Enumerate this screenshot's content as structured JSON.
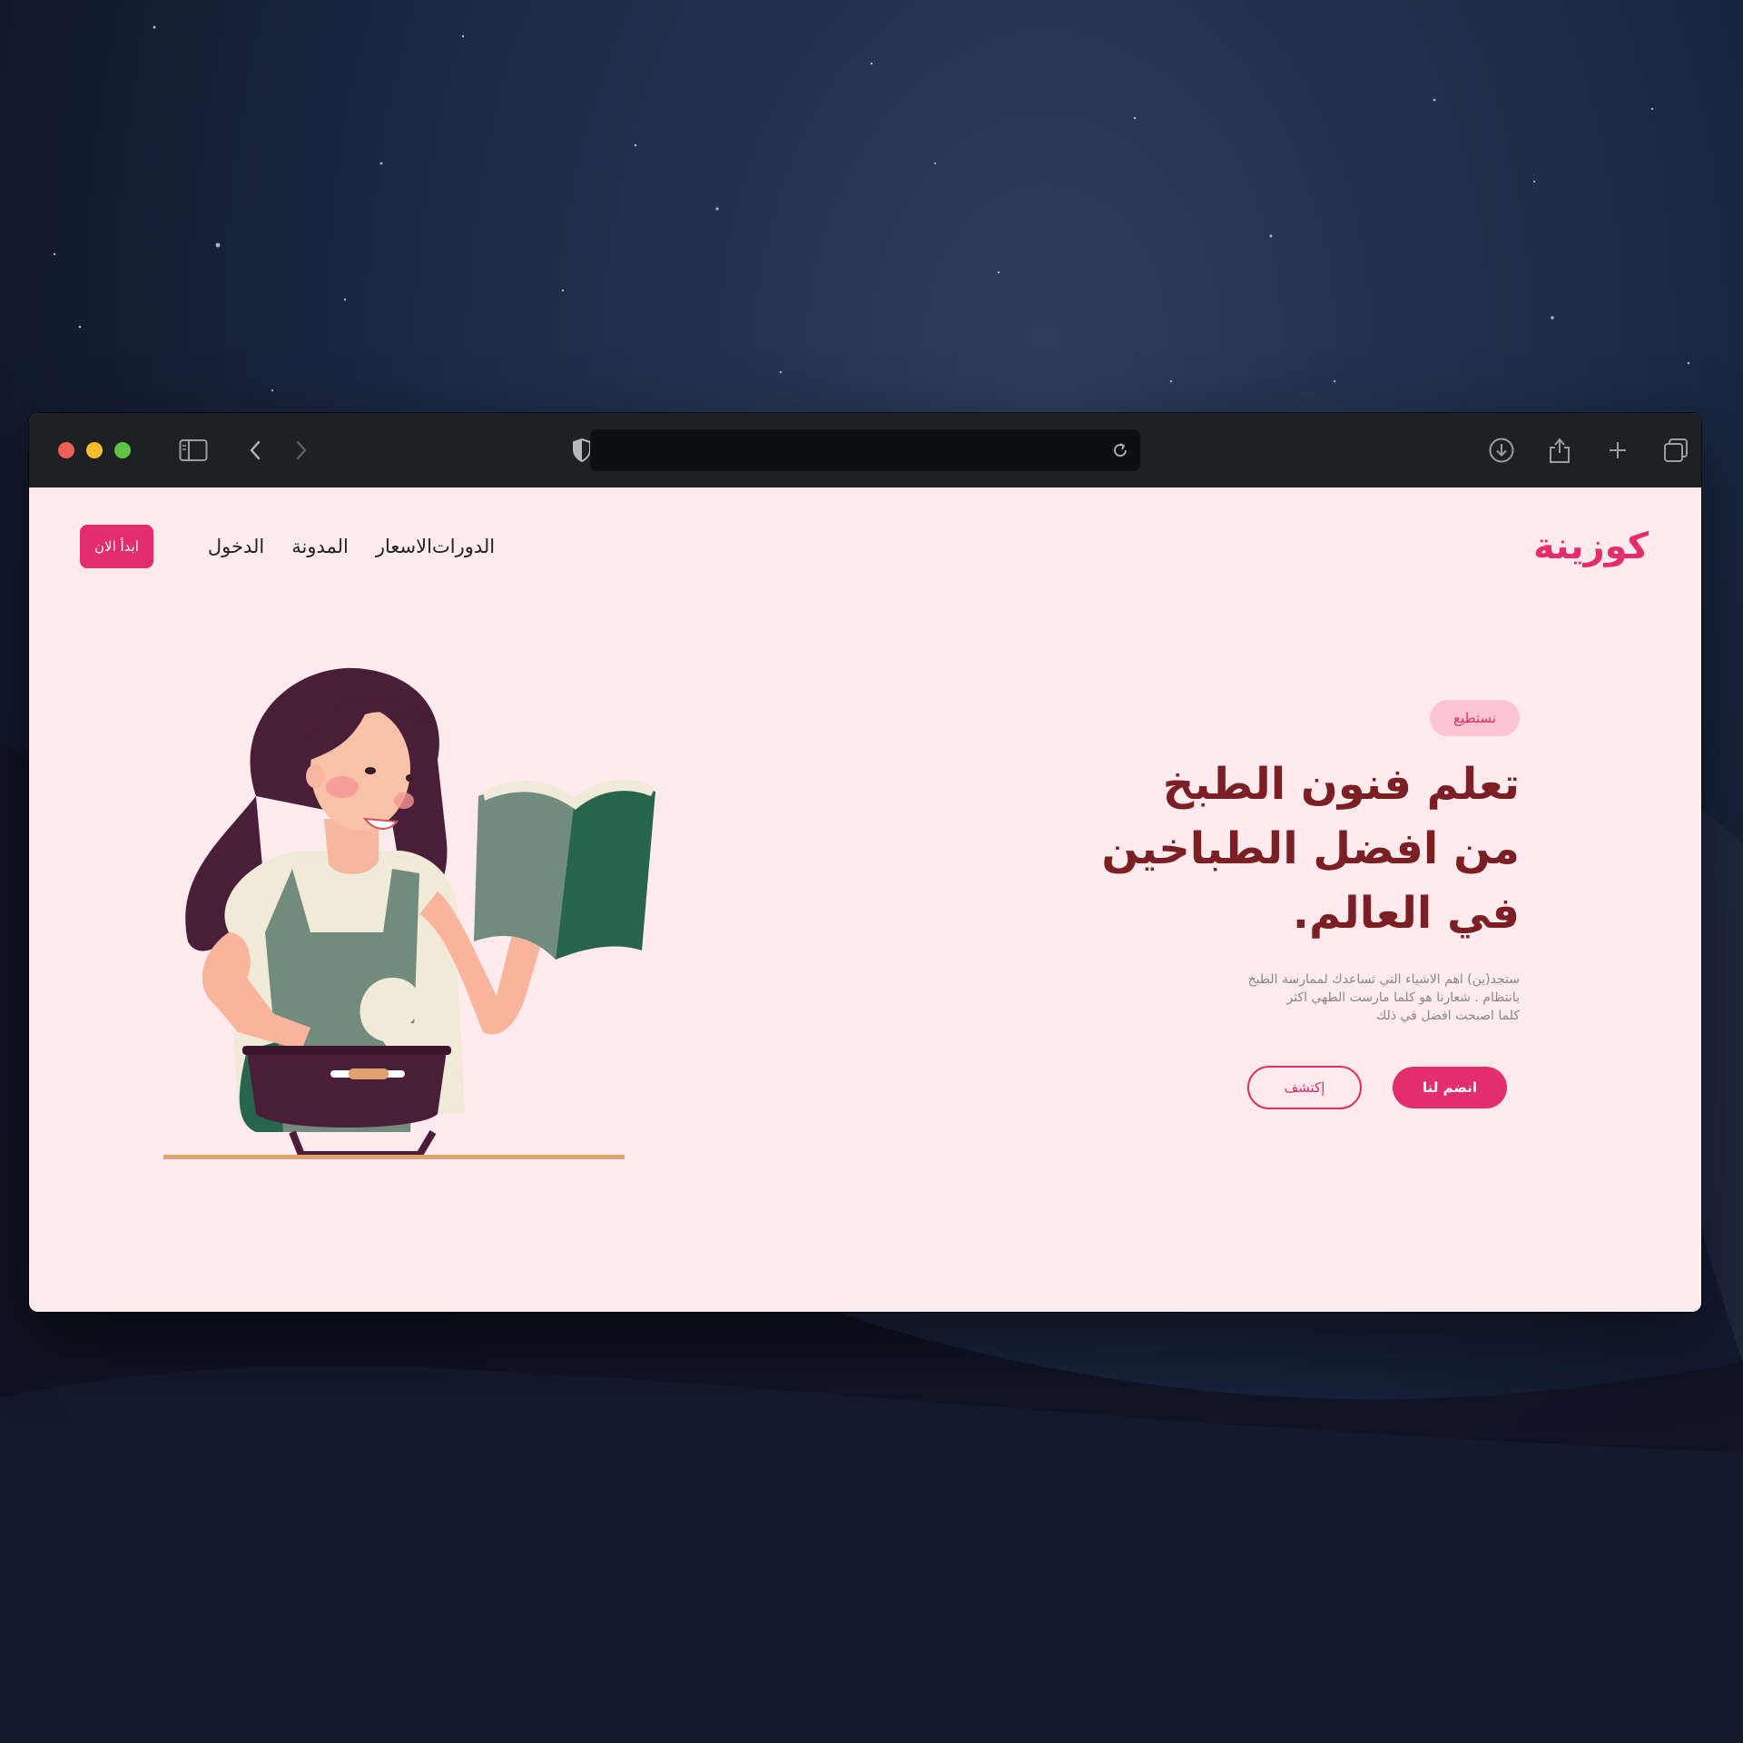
{
  "browser": {
    "url": "",
    "traffic_lights": [
      "close",
      "minimize",
      "zoom"
    ],
    "icons": [
      "sidebar-icon",
      "back-arrow-icon",
      "forward-arrow-icon",
      "shield-icon",
      "reload-icon",
      "download-icon",
      "share-icon",
      "new-tab-icon",
      "tabs-overview-icon"
    ]
  },
  "site": {
    "logo": "كوزينة",
    "nav": {
      "links": [
        "الدورات",
        "الاسعار",
        "المدونة",
        "الدخول"
      ],
      "cta": "ابدأ الان"
    },
    "hero": {
      "badge": "نستطيع",
      "headline_lines": [
        "تعلم فنون الطبخ",
        "من افضل الطباخين",
        "في العالم."
      ],
      "description_lines": [
        "ستجد(ين) اهم الاشياء التي تساعدك لممارسة الطبخ",
        "بانتظام . شعارنا هو كلما مارست الطهي اكثر",
        "كلما اصبحت افضل في ذلك"
      ],
      "primary_button": "انضم لنا",
      "secondary_button": "إكتشف"
    }
  },
  "colors": {
    "accent": "#e32d6d",
    "headline": "#7b1f24",
    "page_background": "#ffebee",
    "badge_background": "#fbc5d1",
    "toolbar": "#1e2023"
  }
}
